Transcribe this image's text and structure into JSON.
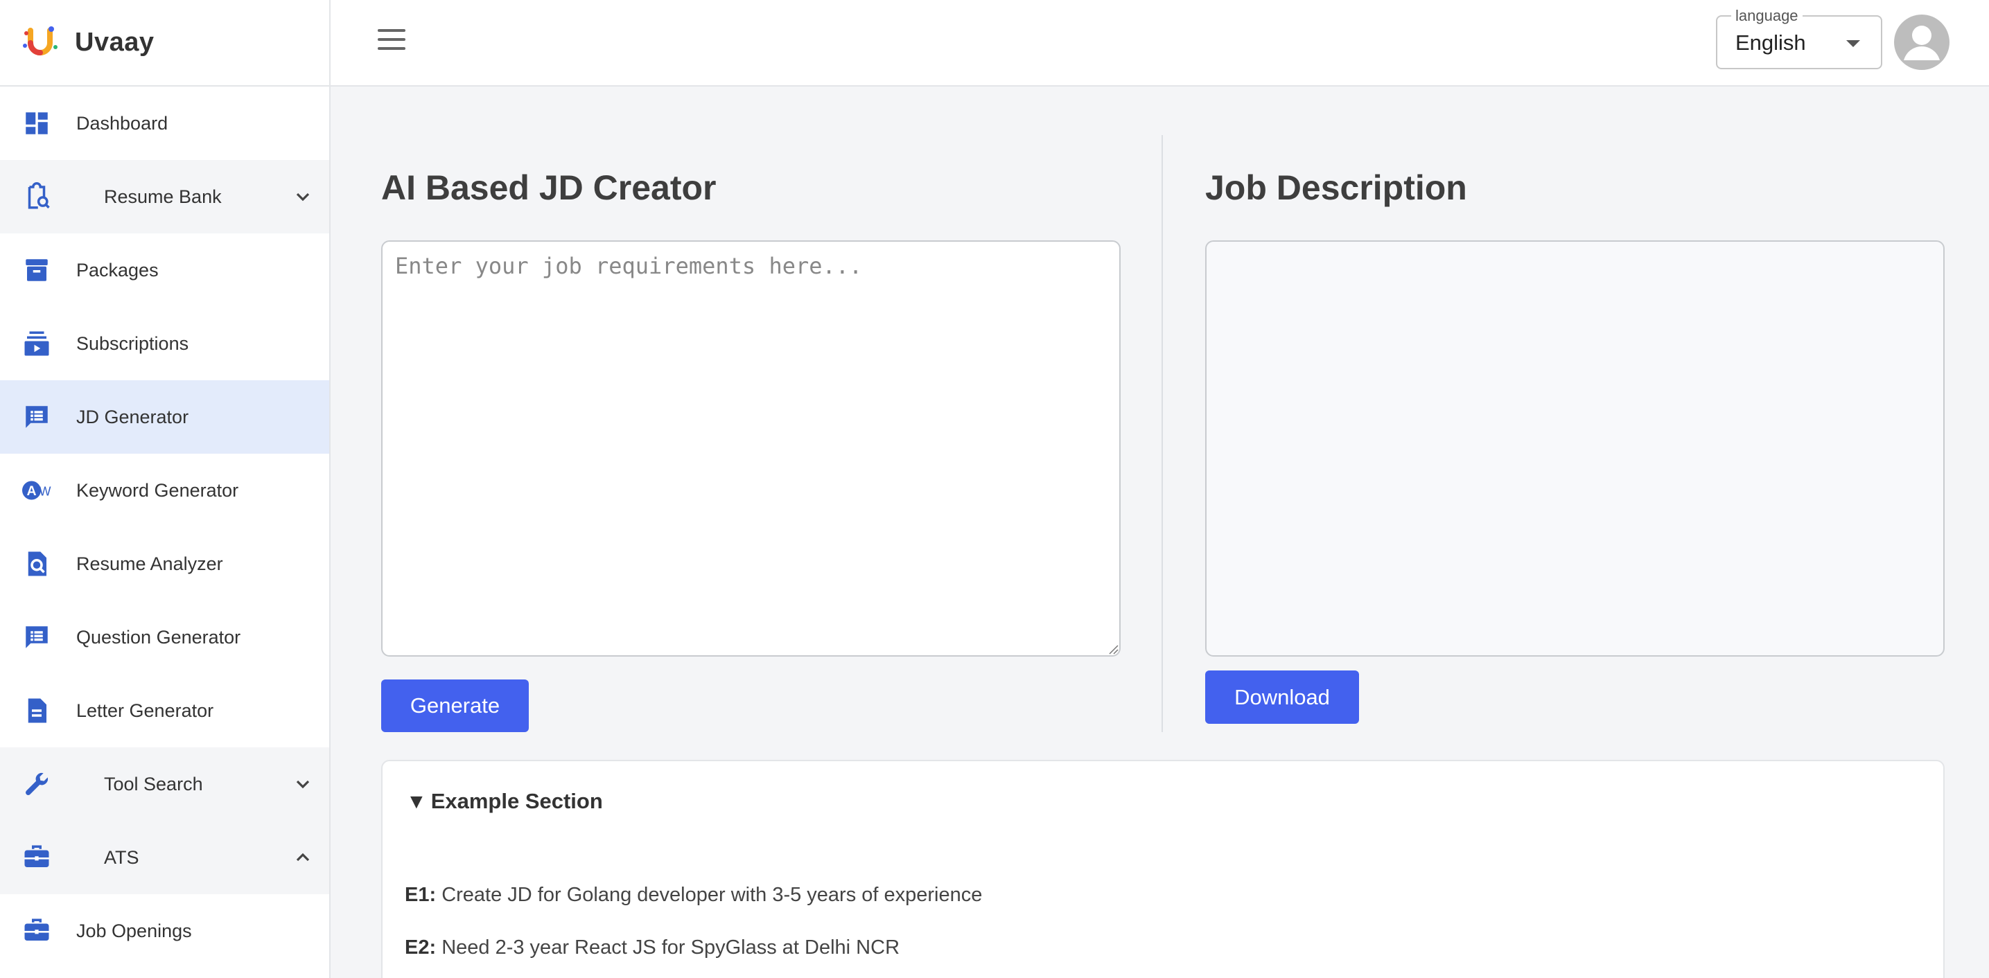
{
  "brand": {
    "name": "Uvaay"
  },
  "sidebar": {
    "items": [
      {
        "label": "Dashboard",
        "icon": "dashboard-icon",
        "style": "plain"
      },
      {
        "label": "Resume Bank",
        "icon": "clipboard-search-icon",
        "style": "group",
        "expanded": false
      },
      {
        "label": "Packages",
        "icon": "archive-icon",
        "style": "plain"
      },
      {
        "label": "Subscriptions",
        "icon": "subscriptions-icon",
        "style": "plain"
      },
      {
        "label": "JD Generator",
        "icon": "chat-list-icon",
        "style": "active"
      },
      {
        "label": "Keyword Generator",
        "icon": "keyword-aw-icon",
        "style": "plain"
      },
      {
        "label": "Resume Analyzer",
        "icon": "file-search-icon",
        "style": "plain"
      },
      {
        "label": "Question Generator",
        "icon": "chat-list-icon",
        "style": "plain"
      },
      {
        "label": "Letter Generator",
        "icon": "document-icon",
        "style": "plain"
      },
      {
        "label": "Tool Search",
        "icon": "wrench-icon",
        "style": "group",
        "expanded": false
      },
      {
        "label": "ATS",
        "icon": "briefcase-icon",
        "style": "group",
        "expanded": true
      },
      {
        "label": "Job Openings",
        "icon": "briefcase-icon",
        "style": "plain"
      }
    ]
  },
  "header": {
    "language": {
      "legend": "language",
      "value": "English"
    }
  },
  "creator": {
    "title": "AI Based JD Creator",
    "placeholder": "Enter your job requirements here...",
    "value": "",
    "generate_label": "Generate"
  },
  "output": {
    "title": "Job Description",
    "content": "",
    "download_label": "Download"
  },
  "examples": {
    "heading": "Example Section",
    "items": [
      {
        "tag": "E1:",
        "text": "Create JD for Golang developer with 3-5 years of experience"
      },
      {
        "tag": "E2:",
        "text": "Need 2-3 year React JS for SpyGlass at Delhi NCR"
      }
    ]
  },
  "colors": {
    "accent": "#4361ee",
    "icon_blue": "#3460c8",
    "active_bg": "#e3ebfb"
  }
}
